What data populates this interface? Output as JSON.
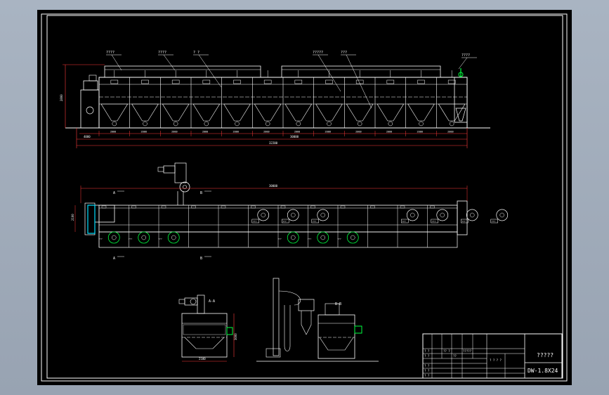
{
  "title_block": {
    "drawing_title": "?????",
    "drawing_number": "DW-1.8X24",
    "cells": [
      "? ?",
      "?? ?",
      "?????",
      "? ?",
      "??",
      "? ? ? ?",
      "? ?",
      "? ?",
      "? ?"
    ]
  },
  "elevation": {
    "callouts": [
      "????",
      "????",
      "? ?",
      "?????",
      "???",
      "????"
    ],
    "bay_labels": [
      "2000",
      "2000",
      "2000",
      "2000",
      "2000",
      "2000",
      "2000",
      "2000",
      "2000",
      "2000",
      "2000",
      "2000"
    ],
    "dim_left": "4000",
    "dim_overall": "30000",
    "dim_total": "32200",
    "dim_height": "2800"
  },
  "plan": {
    "dim_overall": "30000",
    "section_a": "A",
    "section_b": "B",
    "dim_width": "2100",
    "fan_labels_top": [
      "???",
      "???",
      "???",
      "???",
      "???",
      "???",
      "???"
    ],
    "fan_labels_bottom": [
      "???",
      "???",
      "???",
      "???",
      "???",
      "???"
    ]
  },
  "section_aa": {
    "label": "A-A",
    "dim_width": "2100",
    "dim_height": "3000"
  },
  "section_bb": {
    "label": "B-B"
  },
  "colors": {
    "line": "#ffffff",
    "dim": "#ff3b3b",
    "accent": "#00ff40",
    "paper": "#000000",
    "note": "#00e0ff"
  }
}
